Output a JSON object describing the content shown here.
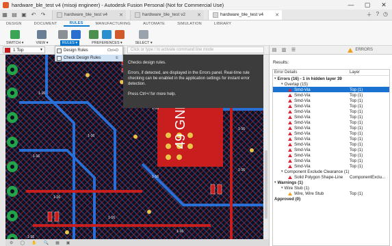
{
  "window": {
    "title": "hardware_ble_test v4 (misoji engineer) - Autodesk Fusion Personal (Not for Commercial Use)",
    "controls": [
      "—",
      "▢",
      "✕"
    ]
  },
  "tabs": [
    {
      "label": "hardware_ble_test v4"
    },
    {
      "label": "hardware_ble_test v2"
    },
    {
      "label": "hardware_ble_test v4"
    }
  ],
  "ribbon": {
    "tabs": [
      "DESIGN",
      "DOCUMENT",
      "RULES",
      "MANUFACTURING",
      "AUTOMATE",
      "SIMULATION",
      "LIBRARY"
    ],
    "active_tab": "RULES",
    "groups": [
      "SWITCH ▾",
      "VIEW ▾",
      "RULES ▾",
      "PREFERENCES ▾",
      "SELECT ▾"
    ]
  },
  "layer": {
    "name": "1 Top",
    "color": "#cc1a1a"
  },
  "command_placeholder": "Click or type / to activate command line mode",
  "dropdown": {
    "items": [
      {
        "label": "Design Rules",
        "shortcut": "Ctrl+D"
      },
      {
        "label": "Check Design Rules",
        "shortcut": "E"
      }
    ]
  },
  "tooltip": {
    "lines": [
      "Checks design rules.",
      "Errors, if detected, are displayed in the Errors panel. Real-time rule checking can be enabled in the application settings for instant error detection.",
      "Press Ctrl+/ for more help."
    ]
  },
  "canvas": {
    "label_big": "49 GND",
    "small_labels": [
      "1-16",
      "1-16",
      "1-16",
      "1-16",
      "1-16",
      "1-16",
      "1-16",
      "1-16",
      "1-16",
      "1-16",
      "1-16",
      "1-16"
    ]
  },
  "status_bar": [
    "⚙",
    "◯",
    "✋",
    "🔍",
    "▦",
    "▣"
  ],
  "panel": {
    "tab_label": "ERRORS",
    "results_label": "Results:",
    "col_error": "Error Details",
    "col_layer": "Layer",
    "rows": [
      {
        "indent": 0,
        "text": "Errors (16) - 1 in hidden layer 39",
        "layer": "",
        "type": "group",
        "caret": "▾"
      },
      {
        "indent": 1,
        "text": "Overlap (15)",
        "layer": "",
        "type": "sub",
        "caret": "▾"
      },
      {
        "indent": 2,
        "text": "Smd-Via",
        "layer": "Top (1)",
        "type": "err",
        "selected": true
      },
      {
        "indent": 2,
        "text": "Smd-Via",
        "layer": "Top (1)",
        "type": "err"
      },
      {
        "indent": 2,
        "text": "Smd-Via",
        "layer": "Top (1)",
        "type": "err"
      },
      {
        "indent": 2,
        "text": "Smd-Via",
        "layer": "Top (1)",
        "type": "err"
      },
      {
        "indent": 2,
        "text": "Smd-Via",
        "layer": "Top (1)",
        "type": "err"
      },
      {
        "indent": 2,
        "text": "Smd-Via",
        "layer": "Top (1)",
        "type": "err"
      },
      {
        "indent": 2,
        "text": "Smd-Via",
        "layer": "Top (1)",
        "type": "err"
      },
      {
        "indent": 2,
        "text": "Smd-Via",
        "layer": "Top (1)",
        "type": "err"
      },
      {
        "indent": 2,
        "text": "Smd-Via",
        "layer": "Top (1)",
        "type": "err"
      },
      {
        "indent": 2,
        "text": "Smd-Via",
        "layer": "Top (1)",
        "type": "err"
      },
      {
        "indent": 2,
        "text": "Smd-Via",
        "layer": "Top (1)",
        "type": "err"
      },
      {
        "indent": 2,
        "text": "Smd-Via",
        "layer": "Top (1)",
        "type": "err"
      },
      {
        "indent": 2,
        "text": "Smd-Via",
        "layer": "Top (1)",
        "type": "err"
      },
      {
        "indent": 2,
        "text": "Smd-Via",
        "layer": "Top (1)",
        "type": "err"
      },
      {
        "indent": 2,
        "text": "Smd-Via",
        "layer": "Top (1)",
        "type": "err"
      },
      {
        "indent": 1,
        "text": "Component Exclude Clearance (1)",
        "layer": "",
        "type": "sub",
        "caret": "▾"
      },
      {
        "indent": 2,
        "text": "Solid Polygon Shape-Line",
        "layer": "ComponentExclu...",
        "type": "err"
      },
      {
        "indent": 0,
        "text": "Warnings (1)",
        "layer": "",
        "type": "group",
        "caret": "▾"
      },
      {
        "indent": 1,
        "text": "Wire Stub (1)",
        "layer": "",
        "type": "sub",
        "caret": "▾"
      },
      {
        "indent": 2,
        "text": "Wire, Wire Stub",
        "layer": "Top (1)",
        "type": "warn"
      },
      {
        "indent": 0,
        "text": "Approved (0)",
        "layer": "",
        "type": "group",
        "caret": ""
      }
    ]
  },
  "colors": {
    "accent": "#0a78d1",
    "selected": "#1a73d0",
    "error": "#dd2233",
    "warning": "#f0a020",
    "copper_top": "#c81e1e",
    "copper_bottom": "#2a6fd6"
  }
}
